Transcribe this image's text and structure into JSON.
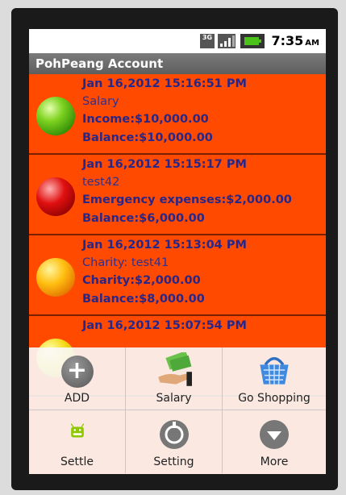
{
  "status_bar": {
    "signal_label": "3G",
    "time": "7:35",
    "ampm": "AM"
  },
  "app_title": "PohPeang Account",
  "entries": [
    {
      "date": "Jan 16,2012 15:16:51 PM",
      "note": "Salary",
      "amount": "Income:$10,000.00",
      "balance": "Balance:$10,000.00",
      "color": "green"
    },
    {
      "date": "Jan 16,2012 15:15:17 PM",
      "note": "test42",
      "amount": "Emergency expenses:$2,000.00",
      "balance": "Balance:$6,000.00",
      "color": "red"
    },
    {
      "date": "Jan 16,2012 15:13:04 PM",
      "note": "Charity: test41",
      "amount": "Charity:$2,000.00",
      "balance": "Balance:$8,000.00",
      "color": "orange"
    },
    {
      "date": "Jan 16,2012 15:07:54 PM",
      "color": "yellow"
    }
  ],
  "menu": [
    {
      "label": "ADD",
      "icon": "add-icon"
    },
    {
      "label": "Salary",
      "icon": "salary-money-icon"
    },
    {
      "label": "Go Shopping",
      "icon": "shopping-basket-icon"
    },
    {
      "label": "Settle",
      "icon": "android-icon"
    },
    {
      "label": "Setting",
      "icon": "settings-icon"
    },
    {
      "label": "More",
      "icon": "more-icon"
    }
  ],
  "colors": {
    "list_bg": "#ff4a00",
    "text": "#27278a",
    "titlebar": "#6b6b6b"
  }
}
